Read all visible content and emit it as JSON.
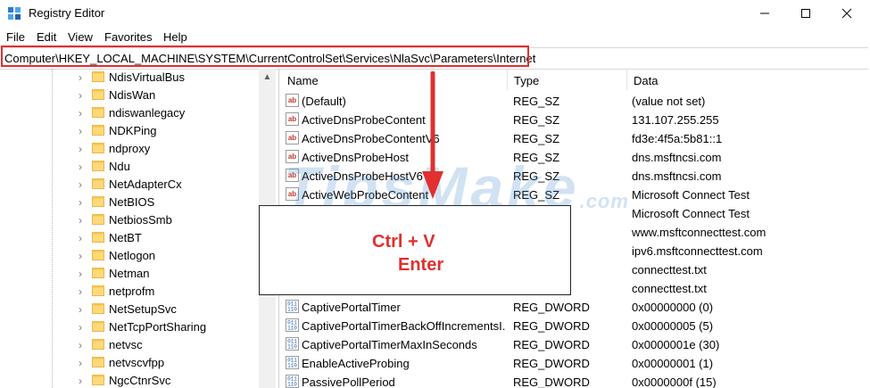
{
  "window": {
    "title": "Registry Editor",
    "app_icon": "registry-icon",
    "controls": [
      "minimize-icon",
      "maximize-icon",
      "close-icon"
    ]
  },
  "menu": [
    "File",
    "Edit",
    "View",
    "Favorites",
    "Help"
  ],
  "address": {
    "path": "Computer\\HKEY_LOCAL_MACHINE\\SYSTEM\\CurrentControlSet\\Services\\NlaSvc\\Parameters\\Internet",
    "highlight_color": "#e0302f"
  },
  "tree": {
    "items": [
      "NdisVirtualBus",
      "NdisWan",
      "ndiswanlegacy",
      "NDKPing",
      "ndproxy",
      "Ndu",
      "NetAdapterCx",
      "NetBIOS",
      "NetbiosSmb",
      "NetBT",
      "Netlogon",
      "Netman",
      "netprofm",
      "NetSetupSvc",
      "NetTcpPortSharing",
      "netvsc",
      "netvscvfpp",
      "NgcCtnrSvc"
    ]
  },
  "columns": [
    "Name",
    "Type",
    "Data"
  ],
  "values": [
    {
      "name": "(Default)",
      "type": "REG_SZ",
      "data": "(value not set)",
      "icon": "string-value-icon"
    },
    {
      "name": "ActiveDnsProbeContent",
      "type": "REG_SZ",
      "data": "131.107.255.255",
      "icon": "string-value-icon"
    },
    {
      "name": "ActiveDnsProbeContentV6",
      "type": "REG_SZ",
      "data": "fd3e:4f5a:5b81::1",
      "icon": "string-value-icon"
    },
    {
      "name": "ActiveDnsProbeHost",
      "type": "REG_SZ",
      "data": "dns.msftncsi.com",
      "icon": "string-value-icon"
    },
    {
      "name": "ActiveDnsProbeHostV6",
      "type": "REG_SZ",
      "data": "dns.msftncsi.com",
      "icon": "string-value-icon"
    },
    {
      "name": "ActiveWebProbeContent",
      "type": "REG_SZ",
      "data": "Microsoft Connect Test",
      "icon": "string-value-icon"
    },
    {
      "name": "",
      "type": "",
      "data": "Microsoft Connect Test",
      "icon": ""
    },
    {
      "name": "",
      "type": "",
      "data": "www.msftconnecttest.com",
      "icon": ""
    },
    {
      "name": "",
      "type": "",
      "data": "ipv6.msftconnecttest.com",
      "icon": ""
    },
    {
      "name": "",
      "type": "",
      "data": "connecttest.txt",
      "icon": ""
    },
    {
      "name": "",
      "type": "",
      "data": "connecttest.txt",
      "icon": ""
    },
    {
      "name": "CaptivePortalTimer",
      "type": "REG_DWORD",
      "data": "0x00000000 (0)",
      "icon": "dword-value-icon"
    },
    {
      "name": "CaptivePortalTimerBackOffIncrementsI...",
      "type": "REG_DWORD",
      "data": "0x00000005 (5)",
      "icon": "dword-value-icon"
    },
    {
      "name": "CaptivePortalTimerMaxInSeconds",
      "type": "REG_DWORD",
      "data": "0x0000001e (30)",
      "icon": "dword-value-icon"
    },
    {
      "name": "EnableActiveProbing",
      "type": "REG_DWORD",
      "data": "0x00000001 (1)",
      "icon": "dword-value-icon"
    },
    {
      "name": "PassivePollPeriod",
      "type": "REG_DWORD",
      "data": "0x0000000f (15)",
      "icon": "dword-value-icon"
    }
  ],
  "overlay": {
    "line1": "Ctrl + V",
    "line2": "Enter",
    "color": "#e0302f",
    "arrow_icon": "down-arrow-icon"
  },
  "watermark": {
    "main": "TipsMake",
    "suffix": ".com",
    "color": "#468ccd"
  }
}
